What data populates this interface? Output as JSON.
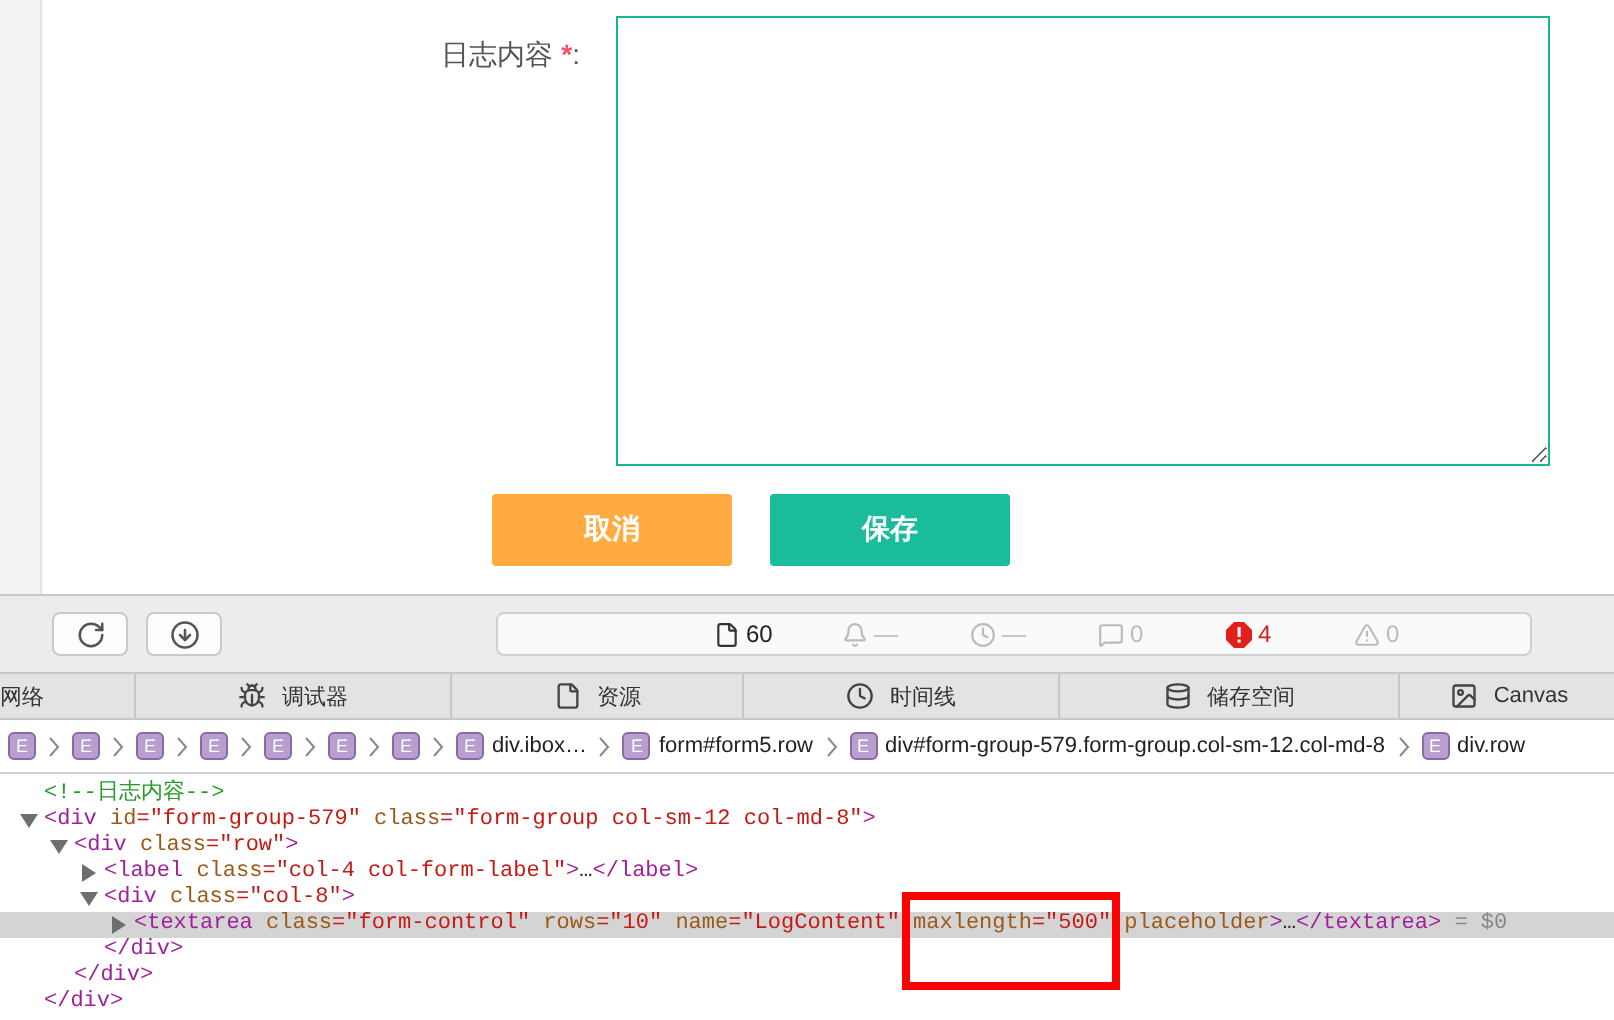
{
  "form": {
    "label": "日志内容",
    "required_mark": "*",
    "colon": ":",
    "buttons": [
      {
        "kind": "cancel",
        "label": "取消"
      },
      {
        "kind": "save",
        "label": "保存"
      }
    ]
  },
  "devtools": {
    "status_items": [
      {
        "kind": "document",
        "text": "60"
      },
      {
        "kind": "bell",
        "text": "—"
      },
      {
        "kind": "clock",
        "text": "—"
      },
      {
        "kind": "message",
        "text": "0"
      },
      {
        "kind": "error",
        "text": "4"
      },
      {
        "kind": "warning",
        "text": "0"
      }
    ],
    "tabs": [
      {
        "kind": "network",
        "label": "网络"
      },
      {
        "kind": "debugger",
        "label": "调试器"
      },
      {
        "kind": "resources",
        "label": "资源"
      },
      {
        "kind": "timeline",
        "label": "时间线"
      },
      {
        "kind": "storage",
        "label": "储存空间"
      },
      {
        "kind": "canvas",
        "label": "Canvas"
      }
    ],
    "breadcrumbs": [
      {
        "badge": "E"
      },
      {
        "badge": "E"
      },
      {
        "badge": "E"
      },
      {
        "badge": "E"
      },
      {
        "badge": "E"
      },
      {
        "badge": "E"
      },
      {
        "badge": "E"
      },
      {
        "badge": "E",
        "label": "div.ibox…"
      },
      {
        "badge": "E",
        "label": "form#form5.row"
      },
      {
        "badge": "E",
        "label": "div#form-group-579.form-group.col-sm-12.col-md-8"
      },
      {
        "badge": "E",
        "label": "div.row"
      }
    ],
    "dom": [
      {
        "kind": "comment",
        "text": "<!--日志内容-->"
      },
      {
        "kind": "element",
        "expanded": true,
        "selected": false,
        "tokens": [
          {
            "kind": "tag",
            "text": "<div"
          },
          {
            "kind": "attr",
            "text": " id"
          },
          {
            "kind": "value",
            "text": "=\"form-group-579\""
          },
          {
            "kind": "attr",
            "text": " class"
          },
          {
            "kind": "value",
            "text": "=\"form-group col-sm-12 col-md-8\""
          },
          {
            "kind": "tag",
            "text": ">"
          }
        ],
        "close": "</div>",
        "children": [
          {
            "kind": "element",
            "expanded": true,
            "selected": false,
            "tokens": [
              {
                "kind": "tag",
                "text": "<div"
              },
              {
                "kind": "attr",
                "text": " class"
              },
              {
                "kind": "value",
                "text": "=\"row\""
              },
              {
                "kind": "tag",
                "text": ">"
              }
            ],
            "close": "</div>",
            "children": [
              {
                "kind": "element",
                "expanded": false,
                "selected": false,
                "tokens": [
                  {
                    "kind": "tag",
                    "text": "<label"
                  },
                  {
                    "kind": "attr",
                    "text": " class"
                  },
                  {
                    "kind": "value",
                    "text": "=\"col-4 col-form-label\""
                  },
                  {
                    "kind": "tag",
                    "text": ">"
                  },
                  {
                    "kind": "plain",
                    "text": "…"
                  },
                  {
                    "kind": "tag",
                    "text": "</label>"
                  }
                ]
              },
              {
                "kind": "element",
                "expanded": true,
                "selected": false,
                "tokens": [
                  {
                    "kind": "tag",
                    "text": "<div"
                  },
                  {
                    "kind": "attr",
                    "text": " class"
                  },
                  {
                    "kind": "value",
                    "text": "=\"col-8\""
                  },
                  {
                    "kind": "tag",
                    "text": ">"
                  }
                ],
                "close": "</div>",
                "children": [
                  {
                    "kind": "element",
                    "expanded": false,
                    "selected": true,
                    "suffix": " = $0",
                    "tokens": [
                      {
                        "kind": "tag",
                        "text": "<textarea"
                      },
                      {
                        "kind": "attr",
                        "text": " class"
                      },
                      {
                        "kind": "value",
                        "text": "=\"form-control\""
                      },
                      {
                        "kind": "attr",
                        "text": " rows"
                      },
                      {
                        "kind": "value",
                        "text": "=\"10\""
                      },
                      {
                        "kind": "attr",
                        "text": " name"
                      },
                      {
                        "kind": "value",
                        "text": "=\"LogContent\""
                      },
                      {
                        "kind": "attr",
                        "text": " maxlength",
                        "highlighted": true
                      },
                      {
                        "kind": "value",
                        "text": "=\"500\""
                      },
                      {
                        "kind": "attr",
                        "text": " placeholder"
                      },
                      {
                        "kind": "tag",
                        "text": ">"
                      },
                      {
                        "kind": "plain",
                        "text": "…"
                      },
                      {
                        "kind": "tag",
                        "text": "</textarea>"
                      }
                    ]
                  }
                ]
              }
            ]
          }
        ]
      }
    ]
  }
}
